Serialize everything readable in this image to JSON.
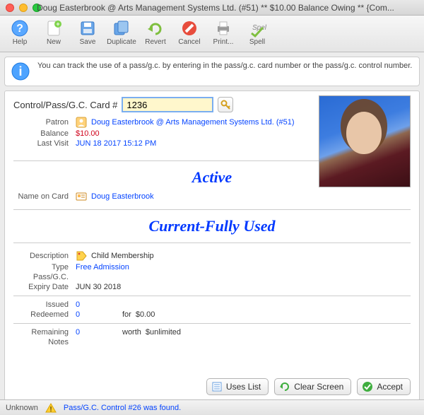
{
  "window": {
    "title": "Doug Easterbrook @ Arts Management Systems Ltd. (#51) ** $10.00 Balance Owing ** {Com..."
  },
  "toolbar": {
    "help": "Help",
    "new": "New",
    "save": "Save",
    "duplicate": "Duplicate",
    "revert": "Revert",
    "cancel": "Cancel",
    "print": "Print...",
    "spell": "Spell"
  },
  "info": {
    "text": "You can track the use of a pass/g.c. by entering in the pass/g.c. card number or the pass/g.c. control number."
  },
  "card": {
    "label": "Control/Pass/G.C. Card #",
    "value": "1236"
  },
  "patron": {
    "label": "Patron",
    "name": "Doug Easterbrook @ Arts Management Systems Ltd. (#51)"
  },
  "balance": {
    "label": "Balance",
    "value": "$10.00"
  },
  "lastvisit": {
    "label": "Last Visit",
    "value": "JUN 18 2017 15:12 PM"
  },
  "status1": "Active",
  "nameoncard": {
    "label": "Name on Card",
    "value": "Doug Easterbrook"
  },
  "status2": "Current-Fully Used",
  "desc": {
    "label": "Description",
    "value": "Child Membership"
  },
  "type": {
    "label": "Type",
    "value": "Free Admission"
  },
  "passgc_label": "Pass/G.C.",
  "expiry": {
    "label": "Expiry Date",
    "value": "JUN 30 2018"
  },
  "issued": {
    "label": "Issued",
    "value": "0"
  },
  "redeemed": {
    "label": "Redeemed",
    "value": "0",
    "for_label": "for",
    "for_value": "$0.00"
  },
  "remaining": {
    "label": "Remaining",
    "value": "0",
    "worth_label": "worth",
    "worth_value": "$unlimited"
  },
  "notes": {
    "label": "Notes"
  },
  "buttons": {
    "uses": "Uses List",
    "clear": "Clear Screen",
    "accept": "Accept"
  },
  "statusbar": {
    "left": "Unknown",
    "found": "Pass/G.C. Control #26 was found."
  }
}
